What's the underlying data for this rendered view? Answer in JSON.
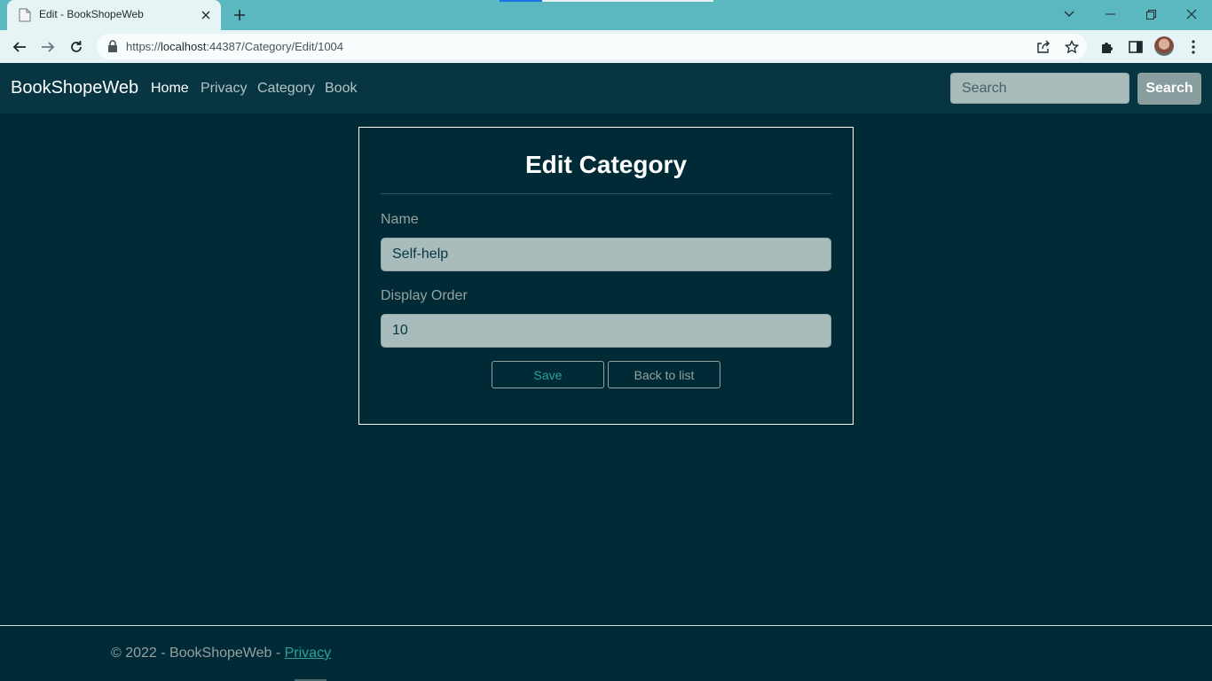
{
  "browser": {
    "tab": {
      "title": "Edit - BookShopeWeb",
      "favicon": "page-icon"
    },
    "url": {
      "scheme": "https://",
      "host": "localhost",
      "rest": ":44387/Category/Edit/1004"
    }
  },
  "site": {
    "brand": "BookShopeWeb",
    "nav": [
      {
        "label": "Home",
        "active": true
      },
      {
        "label": "Privacy"
      },
      {
        "label": "Category"
      },
      {
        "label": "Book"
      }
    ],
    "search": {
      "placeholder": "Search",
      "button_label": "Search"
    }
  },
  "form": {
    "title": "Edit Category",
    "name_label": "Name",
    "name_value": "Self-help",
    "order_label": "Display Order",
    "order_value": "10",
    "save_label": "Save",
    "back_label": "Back to list"
  },
  "footer": {
    "text": "© 2022 - BookShopeWeb - ",
    "link": "Privacy"
  },
  "colors": {
    "page_bg": "#002b36",
    "navbar_bg": "#073642",
    "accent": "#2aa198",
    "tabstrip": "#5bb8c1"
  }
}
